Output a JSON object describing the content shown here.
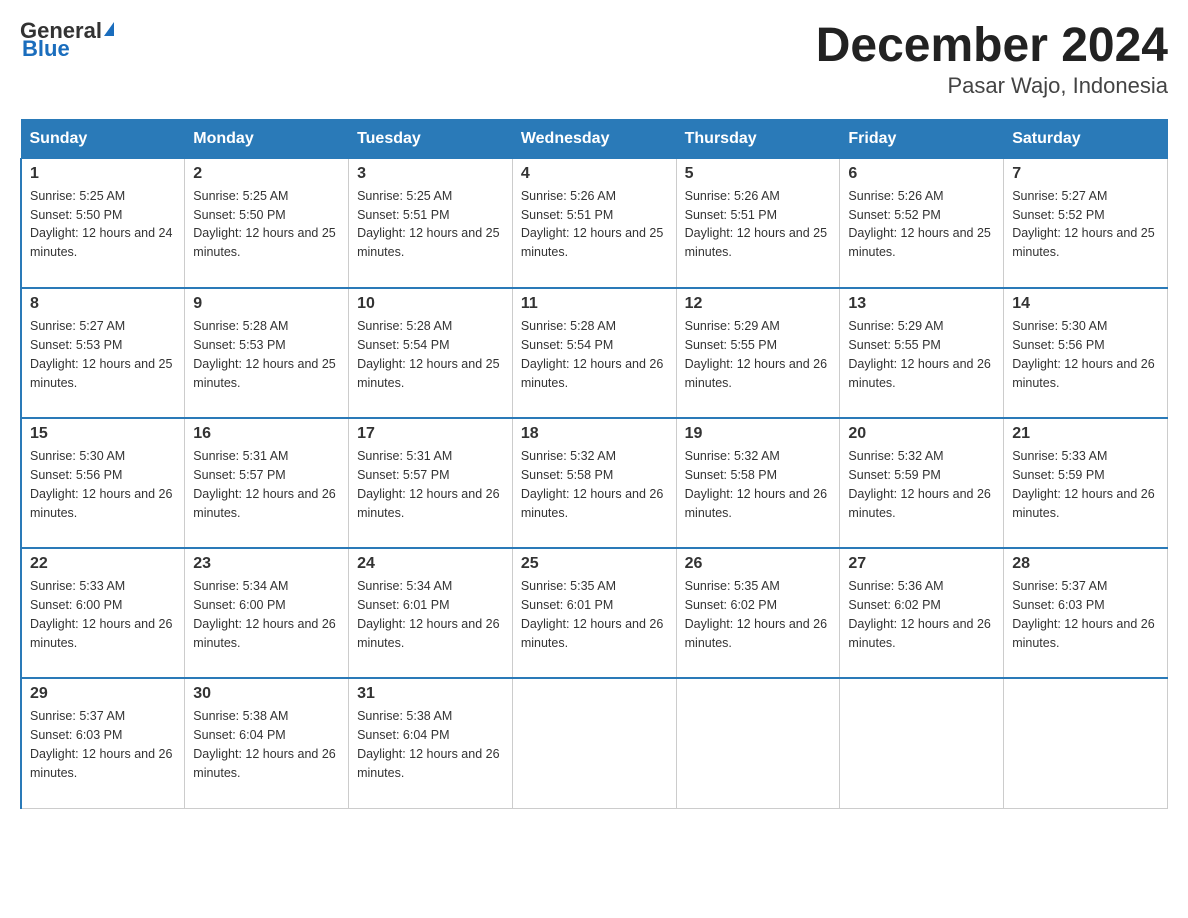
{
  "header": {
    "logo_general": "General",
    "logo_blue": "Blue",
    "title": "December 2024",
    "subtitle": "Pasar Wajo, Indonesia"
  },
  "days_of_week": [
    "Sunday",
    "Monday",
    "Tuesday",
    "Wednesday",
    "Thursday",
    "Friday",
    "Saturday"
  ],
  "weeks": [
    [
      {
        "day": "1",
        "sunrise": "5:25 AM",
        "sunset": "5:50 PM",
        "daylight": "12 hours and 24 minutes."
      },
      {
        "day": "2",
        "sunrise": "5:25 AM",
        "sunset": "5:50 PM",
        "daylight": "12 hours and 25 minutes."
      },
      {
        "day": "3",
        "sunrise": "5:25 AM",
        "sunset": "5:51 PM",
        "daylight": "12 hours and 25 minutes."
      },
      {
        "day": "4",
        "sunrise": "5:26 AM",
        "sunset": "5:51 PM",
        "daylight": "12 hours and 25 minutes."
      },
      {
        "day": "5",
        "sunrise": "5:26 AM",
        "sunset": "5:51 PM",
        "daylight": "12 hours and 25 minutes."
      },
      {
        "day": "6",
        "sunrise": "5:26 AM",
        "sunset": "5:52 PM",
        "daylight": "12 hours and 25 minutes."
      },
      {
        "day": "7",
        "sunrise": "5:27 AM",
        "sunset": "5:52 PM",
        "daylight": "12 hours and 25 minutes."
      }
    ],
    [
      {
        "day": "8",
        "sunrise": "5:27 AM",
        "sunset": "5:53 PM",
        "daylight": "12 hours and 25 minutes."
      },
      {
        "day": "9",
        "sunrise": "5:28 AM",
        "sunset": "5:53 PM",
        "daylight": "12 hours and 25 minutes."
      },
      {
        "day": "10",
        "sunrise": "5:28 AM",
        "sunset": "5:54 PM",
        "daylight": "12 hours and 25 minutes."
      },
      {
        "day": "11",
        "sunrise": "5:28 AM",
        "sunset": "5:54 PM",
        "daylight": "12 hours and 26 minutes."
      },
      {
        "day": "12",
        "sunrise": "5:29 AM",
        "sunset": "5:55 PM",
        "daylight": "12 hours and 26 minutes."
      },
      {
        "day": "13",
        "sunrise": "5:29 AM",
        "sunset": "5:55 PM",
        "daylight": "12 hours and 26 minutes."
      },
      {
        "day": "14",
        "sunrise": "5:30 AM",
        "sunset": "5:56 PM",
        "daylight": "12 hours and 26 minutes."
      }
    ],
    [
      {
        "day": "15",
        "sunrise": "5:30 AM",
        "sunset": "5:56 PM",
        "daylight": "12 hours and 26 minutes."
      },
      {
        "day": "16",
        "sunrise": "5:31 AM",
        "sunset": "5:57 PM",
        "daylight": "12 hours and 26 minutes."
      },
      {
        "day": "17",
        "sunrise": "5:31 AM",
        "sunset": "5:57 PM",
        "daylight": "12 hours and 26 minutes."
      },
      {
        "day": "18",
        "sunrise": "5:32 AM",
        "sunset": "5:58 PM",
        "daylight": "12 hours and 26 minutes."
      },
      {
        "day": "19",
        "sunrise": "5:32 AM",
        "sunset": "5:58 PM",
        "daylight": "12 hours and 26 minutes."
      },
      {
        "day": "20",
        "sunrise": "5:32 AM",
        "sunset": "5:59 PM",
        "daylight": "12 hours and 26 minutes."
      },
      {
        "day": "21",
        "sunrise": "5:33 AM",
        "sunset": "5:59 PM",
        "daylight": "12 hours and 26 minutes."
      }
    ],
    [
      {
        "day": "22",
        "sunrise": "5:33 AM",
        "sunset": "6:00 PM",
        "daylight": "12 hours and 26 minutes."
      },
      {
        "day": "23",
        "sunrise": "5:34 AM",
        "sunset": "6:00 PM",
        "daylight": "12 hours and 26 minutes."
      },
      {
        "day": "24",
        "sunrise": "5:34 AM",
        "sunset": "6:01 PM",
        "daylight": "12 hours and 26 minutes."
      },
      {
        "day": "25",
        "sunrise": "5:35 AM",
        "sunset": "6:01 PM",
        "daylight": "12 hours and 26 minutes."
      },
      {
        "day": "26",
        "sunrise": "5:35 AM",
        "sunset": "6:02 PM",
        "daylight": "12 hours and 26 minutes."
      },
      {
        "day": "27",
        "sunrise": "5:36 AM",
        "sunset": "6:02 PM",
        "daylight": "12 hours and 26 minutes."
      },
      {
        "day": "28",
        "sunrise": "5:37 AM",
        "sunset": "6:03 PM",
        "daylight": "12 hours and 26 minutes."
      }
    ],
    [
      {
        "day": "29",
        "sunrise": "5:37 AM",
        "sunset": "6:03 PM",
        "daylight": "12 hours and 26 minutes."
      },
      {
        "day": "30",
        "sunrise": "5:38 AM",
        "sunset": "6:04 PM",
        "daylight": "12 hours and 26 minutes."
      },
      {
        "day": "31",
        "sunrise": "5:38 AM",
        "sunset": "6:04 PM",
        "daylight": "12 hours and 26 minutes."
      },
      null,
      null,
      null,
      null
    ]
  ],
  "labels": {
    "sunrise_prefix": "Sunrise: ",
    "sunset_prefix": "Sunset: ",
    "daylight_prefix": "Daylight: "
  }
}
